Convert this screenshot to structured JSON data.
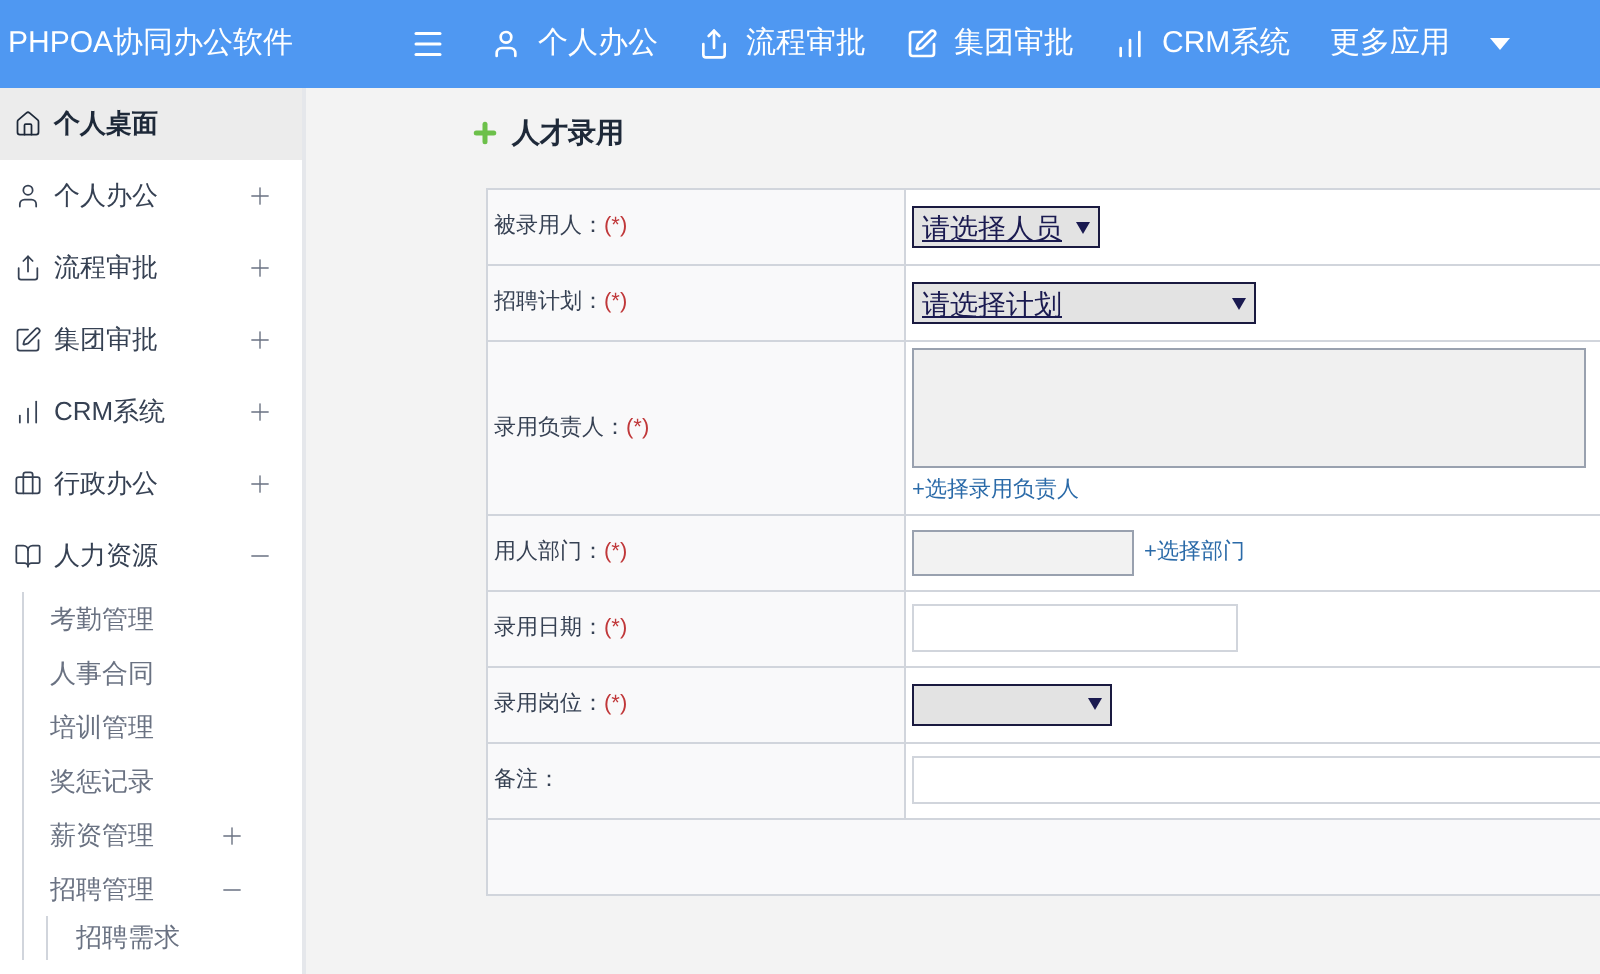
{
  "header": {
    "title": "PHPOA协同办公软件",
    "nav": [
      {
        "label": "个人办公"
      },
      {
        "label": "流程审批"
      },
      {
        "label": "集团审批"
      },
      {
        "label": "CRM系统"
      },
      {
        "label": "更多应用",
        "dropdown": true
      }
    ]
  },
  "sidebar": {
    "items": [
      {
        "label": "个人桌面",
        "selected": true
      },
      {
        "label": "个人办公",
        "selected": false,
        "expanded": false
      },
      {
        "label": "流程审批",
        "selected": false,
        "expanded": false
      },
      {
        "label": "集团审批",
        "selected": false,
        "expanded": false
      },
      {
        "label": "CRM系统",
        "selected": false,
        "expanded": false
      },
      {
        "label": "行政办公",
        "selected": false,
        "expanded": false
      },
      {
        "label": "人力资源",
        "selected": false,
        "expanded": true,
        "children": [
          {
            "label": "考勤管理"
          },
          {
            "label": "人事合同"
          },
          {
            "label": "培训管理"
          },
          {
            "label": "奖惩记录"
          },
          {
            "label": "薪资管理",
            "expanded": false
          },
          {
            "label": "招聘管理",
            "expanded": true,
            "children": [
              {
                "label": "招聘需求"
              }
            ]
          }
        ]
      }
    ]
  },
  "form": {
    "title": "人才录用",
    "rows": [
      {
        "label": "被录用人：",
        "required": "(*)",
        "kind": "fit-select",
        "value": "请选择人员"
      },
      {
        "label": "招聘计划：",
        "required": "(*)",
        "kind": "wide-select",
        "value": "请选择计划"
      },
      {
        "label": "录用负责人：",
        "required": "(*)",
        "kind": "textarea",
        "link": "+选择录用负责人"
      },
      {
        "label": "用人部门：",
        "required": "(*)",
        "kind": "picker",
        "link": "+选择部门"
      },
      {
        "label": "录用日期：",
        "required": "(*)",
        "kind": "input"
      },
      {
        "label": "录用岗位：",
        "required": "(*)",
        "kind": "narrow-select"
      },
      {
        "label": "备注：",
        "kind": "wide-input"
      }
    ]
  }
}
